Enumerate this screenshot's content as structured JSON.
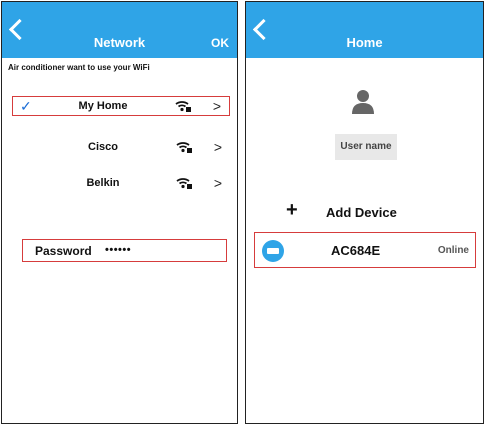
{
  "network_screen": {
    "title": "Network",
    "ok_label": "OK",
    "prompt": "Air conditioner want to use your WiFi",
    "networks": [
      {
        "name": "My Home",
        "selected": true,
        "check": "✓"
      },
      {
        "name": "Cisco",
        "selected": false
      },
      {
        "name": "Belkin",
        "selected": false
      }
    ],
    "chevron": ">",
    "password_label": "Password",
    "password_value": "••••••"
  },
  "home_screen": {
    "title": "Home",
    "user_name": "User name",
    "add_device_plus": "+",
    "add_device_label": "Add Device",
    "device": {
      "name": "AC684E",
      "status": "Online"
    }
  },
  "colors": {
    "header": "#2fa4e7",
    "highlight_border": "#d63c3c",
    "check": "#1a6cd6"
  },
  "icons": [
    "back-arrow-icon",
    "wifi-locked-icon",
    "chevron-right-icon",
    "user-icon",
    "plus-icon",
    "ac-device-icon"
  ]
}
